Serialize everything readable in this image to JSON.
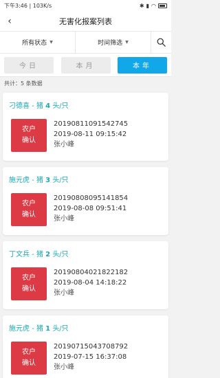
{
  "status": {
    "time": "下午3:46",
    "speed": "103K/s"
  },
  "header": {
    "title": "无害化报案列表"
  },
  "filters": {
    "status_label": "所有状态",
    "time_label": "时间筛选"
  },
  "tabs": [
    {
      "label": "今日",
      "active": false
    },
    {
      "label": "本月",
      "active": false
    },
    {
      "label": "本年",
      "active": true
    }
  ],
  "summary": {
    "total_text": "共计：5 条数据"
  },
  "records": [
    {
      "name": "刁德喜",
      "animal": "猪",
      "count": "4",
      "unit": "头/只",
      "button_line1": "农户",
      "button_line2": "确认",
      "code": "20190811091542745",
      "datetime": "2019-08-11 09:15:42",
      "person": "张小峰"
    },
    {
      "name": "施元虎",
      "animal": "猪",
      "count": "3",
      "unit": "头/只",
      "button_line1": "农户",
      "button_line2": "确认",
      "code": "20190808095141854",
      "datetime": "2019-08-08 09:51:41",
      "person": "张小峰"
    },
    {
      "name": "丁文兵",
      "animal": "猪",
      "count": "2",
      "unit": "头/只",
      "button_line1": "农户",
      "button_line2": "确认",
      "code": "20190804021822182",
      "datetime": "2019-08-04 14:18:22",
      "person": "张小峰"
    },
    {
      "name": "施元虎",
      "animal": "猪",
      "count": "1",
      "unit": "头/只",
      "button_line1": "农户",
      "button_line2": "确认",
      "code": "20190715043708792",
      "datetime": "2019-07-15 16:37:08",
      "person": "张小峰"
    }
  ],
  "colors": {
    "accent": "#11a7e8",
    "name_color": "#19a9b5",
    "confirm_bg": "#dc3a45"
  }
}
